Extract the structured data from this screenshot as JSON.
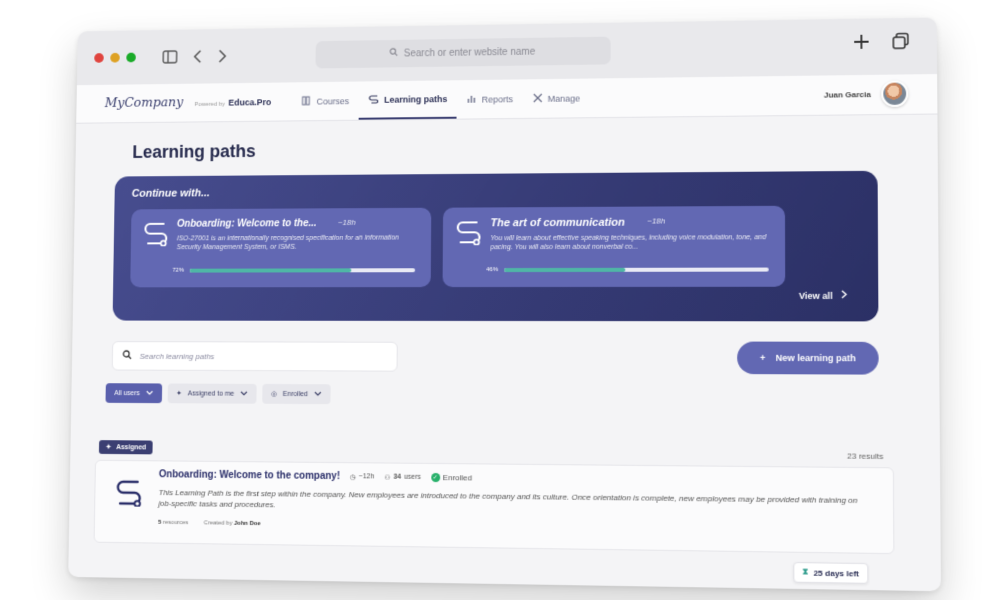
{
  "browser": {
    "address_placeholder": "Search or enter website name"
  },
  "nav": {
    "logo": "MyCompany",
    "powered_by": "Powered by",
    "powered_brand": "Educa.Pro",
    "items": [
      {
        "label": "Courses",
        "icon": "book-icon"
      },
      {
        "label": "Learning paths",
        "icon": "path-icon"
      },
      {
        "label": "Reports",
        "icon": "chart-icon"
      },
      {
        "label": "Manage",
        "icon": "tools-icon"
      }
    ],
    "active_index": 1,
    "user_name": "Juan Garcia"
  },
  "page": {
    "title": "Learning paths"
  },
  "continue": {
    "heading": "Continue with...",
    "cards": [
      {
        "title": "Onboarding: Welcome to the...",
        "time": "~18h",
        "description": "ISO-27001 is an internationally recognised specification for an Information Security Management System, or ISMS.",
        "progress_label": "72%",
        "progress": 0.72
      },
      {
        "title": "The art of communication",
        "time": "~18h",
        "description": "You will learn about effective speaking techniques, including voice modulation, tone, and pacing. You will also learn about nonverbal co...",
        "progress_label": "46%",
        "progress": 0.46
      }
    ],
    "view_all": "View all"
  },
  "toolbar": {
    "search_placeholder": "Search learning paths",
    "new_button": "New learning path"
  },
  "filters": [
    {
      "label": "All users",
      "active": true
    },
    {
      "label": "Assigned to me",
      "active": false
    },
    {
      "label": "Enrolled",
      "active": false
    }
  ],
  "results": "23 results",
  "list": {
    "tag": "Assigned",
    "item": {
      "title": "Onboarding: Welcome to the company!",
      "time": "~12h",
      "users_count": "34",
      "users_label": "users",
      "status": "Enrolled",
      "description": "This Learning Path is the first step within the company. New employees are introduced to the company and its culture. Once orientation is complete, new employees may be provided with training on job-specific tasks and procedures.",
      "resources_count": "5",
      "resources_label": "resources",
      "created_by_label": "Created by",
      "created_by": "John Doe",
      "days_left": "25 days left"
    }
  },
  "colors": {
    "primary": "#6268b3",
    "banner": "#353a74",
    "progress": "#4fb6a6",
    "enrolled": "#27b06a"
  }
}
